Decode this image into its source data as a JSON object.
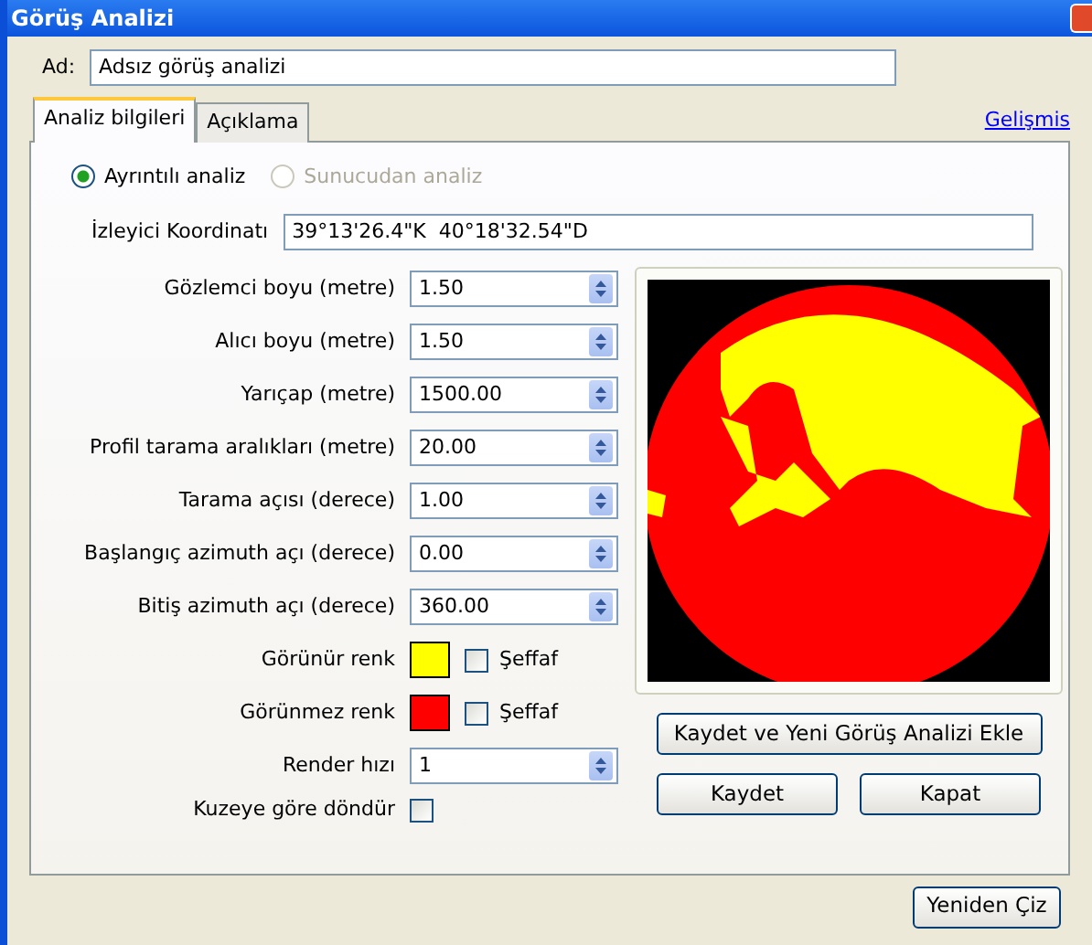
{
  "window": {
    "title": "Görüş Analizi"
  },
  "name_field": {
    "label": "Ad:",
    "value": "Adsız görüş analizi"
  },
  "tabs": [
    {
      "label": "Analiz bilgileri",
      "selected": true
    },
    {
      "label": "Açıklama",
      "selected": false
    }
  ],
  "advanced_link": "Gelişmis",
  "radios": [
    {
      "label": "Ayrıntılı analiz",
      "selected": true,
      "disabled": false
    },
    {
      "label": "Sunucudan analiz",
      "selected": false,
      "disabled": true
    }
  ],
  "coordinate": {
    "label": "İzleyici Koordinatı",
    "value": "39°13'26.4\"K  40°18'32.54\"D"
  },
  "numeric_fields": [
    {
      "label": "Gözlemci boyu (metre)",
      "value": "1.50"
    },
    {
      "label": "Alıcı boyu (metre)",
      "value": "1.50"
    },
    {
      "label": "Yarıçap (metre)",
      "value": "1500.00"
    },
    {
      "label": "Profil tarama aralıkları (metre)",
      "value": "20.00"
    },
    {
      "label": "Tarama açısı (derece)",
      "value": "1.00"
    },
    {
      "label": "Başlangıç azimuth açı (derece)",
      "value": "0.00"
    },
    {
      "label": "Bitiş azimuth açı (derece)",
      "value": "360.00"
    }
  ],
  "color_rows": [
    {
      "label": "Görünür renk",
      "color": "#ffff00",
      "transparent": {
        "label": "Şeffaf",
        "checked": false
      }
    },
    {
      "label": "Görünmez renk",
      "color": "#ff0000",
      "transparent": {
        "label": "Şeffaf",
        "checked": false
      }
    }
  ],
  "render_speed": {
    "label": "Render hızı",
    "value": "1"
  },
  "rotate_north": {
    "label": "Kuzeye göre döndür",
    "checked": false
  },
  "buttons": [
    "Kaydet ve Yeni Görüş Analizi Ekle",
    "Kaydet",
    "Kapat"
  ],
  "redraw_button": "Yeniden Çiz"
}
